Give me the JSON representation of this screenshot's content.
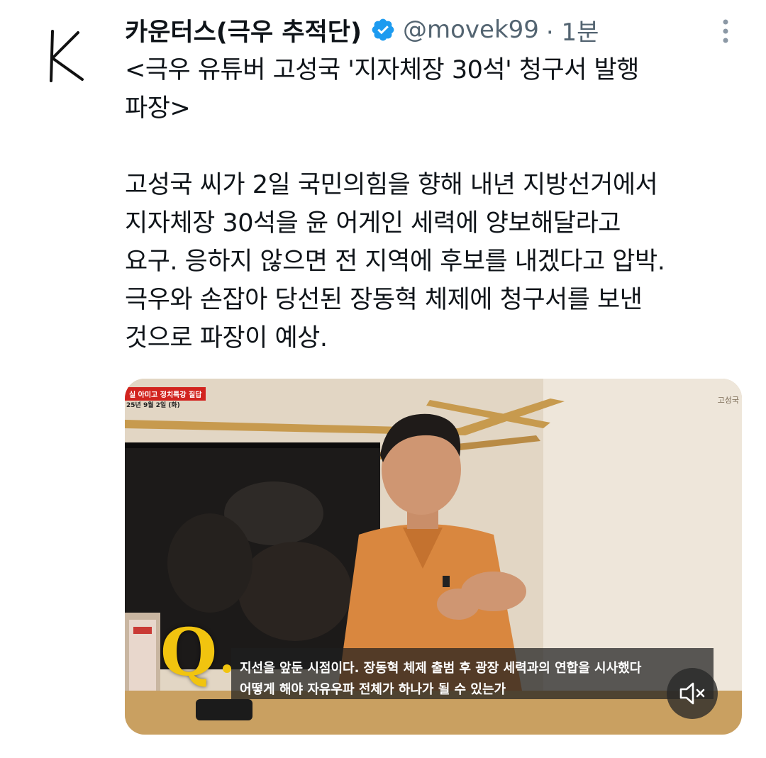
{
  "tweet": {
    "author": {
      "display_name": "카운터스(극우 추적단)",
      "handle": "@movek99",
      "time": "· 1분",
      "avatar_letter": "K",
      "verified": true
    },
    "text": {
      "lines": [
        "<극우 유튜버 고성국 '지자체장 30석' 청구서 발행",
        "파장>",
        "",
        "고성국 씨가 2일 국민의힘을 향해 내년 지방선거에서",
        "지자체장 30석을 윤 어게인 세력에 양보해달라고",
        "요구. 응하지 않으면 전 지역에 후보를 내겠다고 압박.",
        "극우와 손잡아 당선된 장동혁 체제에 청구서를 보낸",
        "것으로 파장이 예상."
      ]
    },
    "media": {
      "type": "video",
      "broadcast_tag": "실 아미고 정치특강 질답",
      "broadcast_date": "25년 9월 2일 (화)",
      "channel_mark": "고성국",
      "q_mark": "Q",
      "subtitle_lines": [
        "지선을 앞둔 시점이다. 장동혁 체제 출범 후 광장 세력과의 연합을 시사했다",
        "어떻게 해야 자유우파 전체가 하나가 될 수 있는가"
      ],
      "muted": true
    }
  },
  "colors": {
    "text": "#0f1419",
    "secondary": "#536471",
    "verified": "#1d9bf0",
    "q_mark": "#f1c40f",
    "tag": "#d2241f"
  },
  "icons": {
    "verified": "verified-badge-icon",
    "more": "more-vertical-icon",
    "mute": "speaker-muted-icon"
  }
}
